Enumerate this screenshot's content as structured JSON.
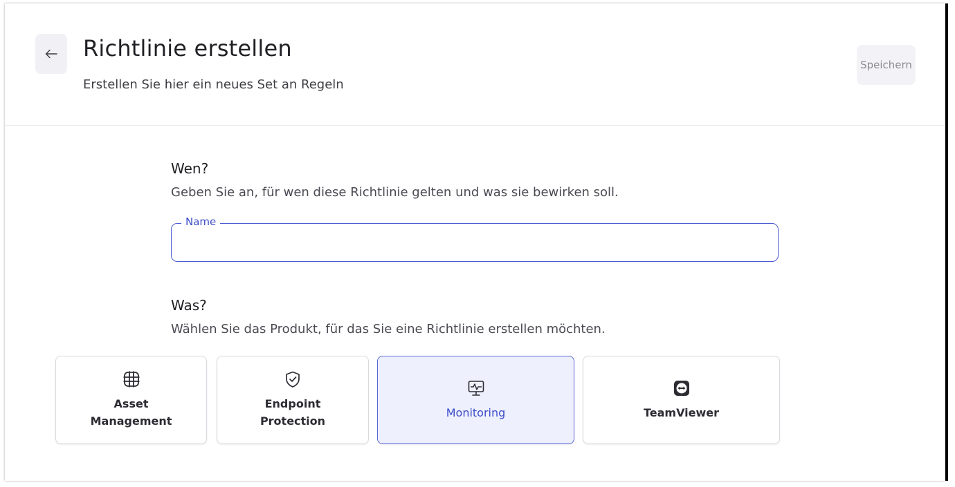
{
  "header": {
    "title": "Richtlinie erstellen",
    "subtitle": "Erstellen Sie hier ein neues Set an Regeln",
    "save_label": "Speichern"
  },
  "who": {
    "heading": "Wen?",
    "description": "Geben Sie an, für wen diese Richtlinie gelten und was sie bewirken soll.",
    "name_label": "Name",
    "name_value": ""
  },
  "what": {
    "heading": "Was?",
    "description": "Wählen Sie das Produkt, für das Sie eine Richtlinie erstellen möchten.",
    "products": [
      {
        "label": "Asset\nManagement",
        "icon": "asset-grid-icon",
        "selected": false
      },
      {
        "label": "Endpoint\nProtection",
        "icon": "shield-check-icon",
        "selected": false
      },
      {
        "label": "Monitoring",
        "icon": "monitor-pulse-icon",
        "selected": true
      },
      {
        "label": "TeamViewer",
        "icon": "teamviewer-icon",
        "selected": false
      }
    ]
  },
  "colors": {
    "accent": "#3b4cc8",
    "selected_bg": "#eef0fd",
    "border": "#d9d9df"
  }
}
